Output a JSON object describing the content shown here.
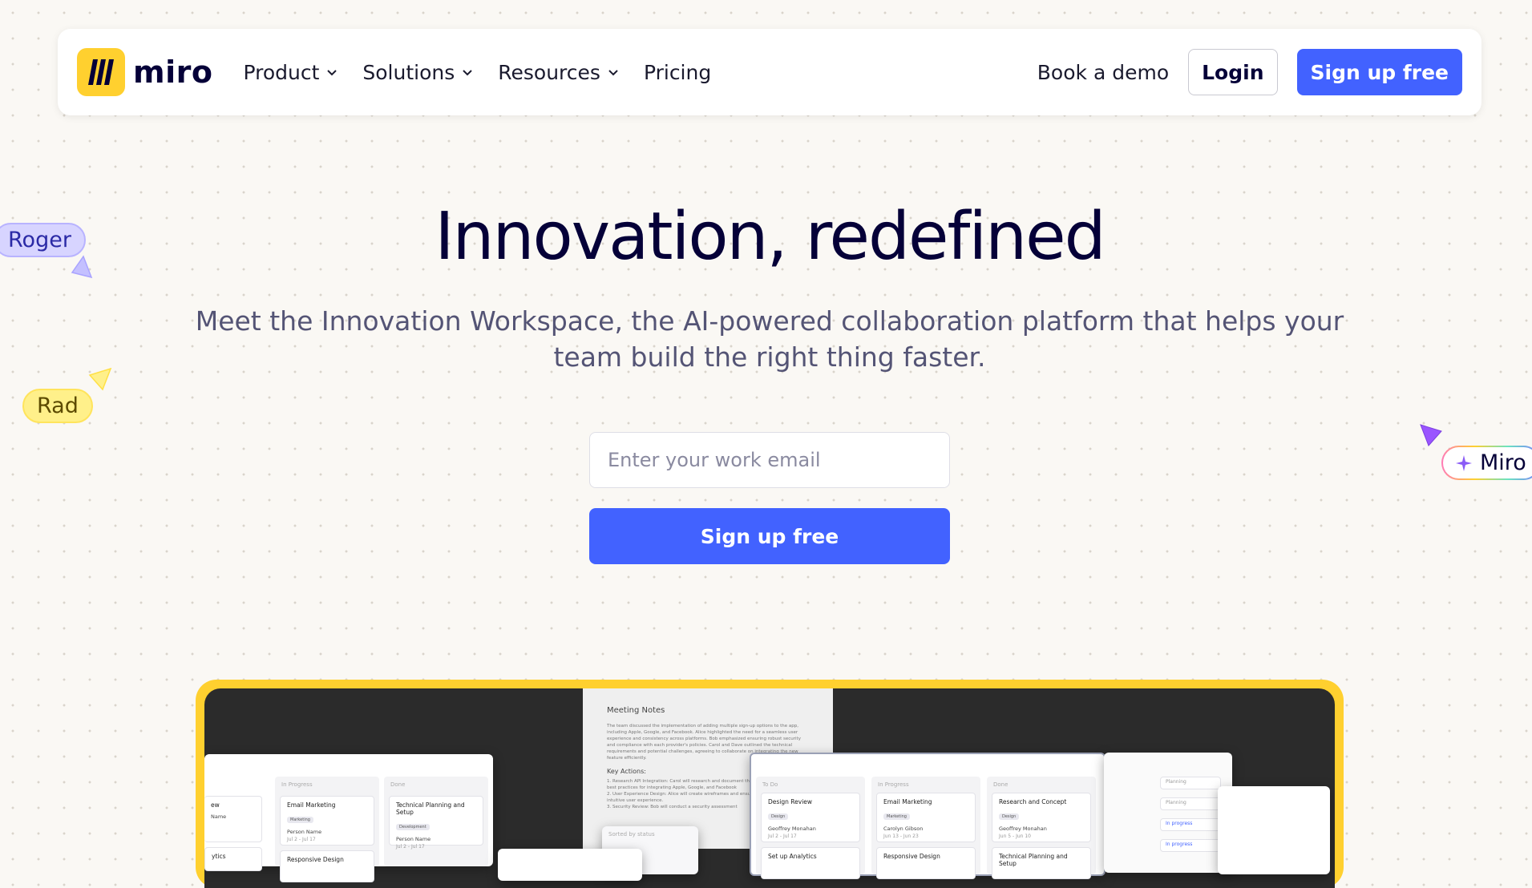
{
  "nav": {
    "brand": "miro",
    "menu": [
      {
        "label": "Product",
        "has_dropdown": true
      },
      {
        "label": "Solutions",
        "has_dropdown": true
      },
      {
        "label": "Resources",
        "has_dropdown": true
      },
      {
        "label": "Pricing",
        "has_dropdown": false
      }
    ],
    "book_demo": "Book a demo",
    "login": "Login",
    "signup": "Sign up free"
  },
  "hero": {
    "title": "Innovation, redefined",
    "subtitle": "Meet the Innovation Workspace, the AI-powered collaboration platform that helps your team build the right thing faster.",
    "email_placeholder": "Enter your work email",
    "signup": "Sign up free"
  },
  "cursors": {
    "roger": "Roger",
    "rad": "Rad",
    "miro": "Miro"
  },
  "preview": {
    "notes_title": "Meeting Notes",
    "notes_body": "The team discussed the implementation of adding multiple sign-up options to the app, including Apple, Google, and Facebook. Alice highlighted the need for a seamless user experience and consistency across platforms. Bob emphasized ensuring robust security and compliance with each provider's policies. Carol and Dave outlined the technical requirements and potential challenges, agreeing to collaborate on integrating the new feature efficiently.",
    "key_actions": "Key Actions:",
    "actions": [
      "1. Research API Integration: Carol will research and document the API requirements and best practices for integrating Apple, Google, and Facebook",
      "2. User Experience Design: Alice will create wireframes and ensure a seamless and intuitive user experience.",
      "3. Security Review: Bob will conduct a security assessment"
    ],
    "left_board": {
      "columns": [
        "In Progress",
        "Done"
      ],
      "cards": [
        {
          "title": "Email Marketing",
          "tag": "Marketing",
          "person": "Person Name",
          "date": "Jul 2 - Jul 17"
        },
        {
          "title": "Technical Planning and Setup",
          "tag": "Development",
          "person": "Person Name",
          "date": "Jul 2 - Jul 17"
        },
        {
          "title": "Responsive Design",
          "tag": "",
          "person": "",
          "date": ""
        }
      ],
      "partial_left": [
        "ew",
        "Name",
        "ytics"
      ]
    },
    "right_board": {
      "columns": [
        "To Do",
        "In Progress",
        "Done"
      ],
      "cards": [
        {
          "title": "Design Review",
          "tag": "Design",
          "person": "Geoffrey Monahan",
          "date": "Jul 2 - Jul 17"
        },
        {
          "title": "Email Marketing",
          "tag": "Marketing",
          "person": "Carolyn Gibson",
          "date": "Jun 13 - Jun 23"
        },
        {
          "title": "Research and Concept",
          "tag": "Design",
          "person": "Geoffrey Monahan",
          "date": "Jun 5 - Jun 10"
        },
        {
          "title": "Set up Analytics",
          "tag": "",
          "person": "",
          "date": ""
        },
        {
          "title": "Responsive Design",
          "tag": "",
          "person": "",
          "date": ""
        },
        {
          "title": "Technical Planning and Setup",
          "tag": "",
          "person": "",
          "date": ""
        }
      ]
    },
    "side_panel": {
      "status_chips": [
        "Planning",
        "Planning",
        "In progress",
        "In progress"
      ]
    },
    "sorted_by": "Sorted by status"
  },
  "colors": {
    "brand_yellow": "#ffd02f",
    "primary_blue": "#4262ff",
    "text_dark": "#050038",
    "background": "#faf8f4"
  },
  "icons": [
    "miro-logo-icon",
    "chevron-down-icon",
    "cursor-arrow-icon",
    "sparkle-icon"
  ]
}
